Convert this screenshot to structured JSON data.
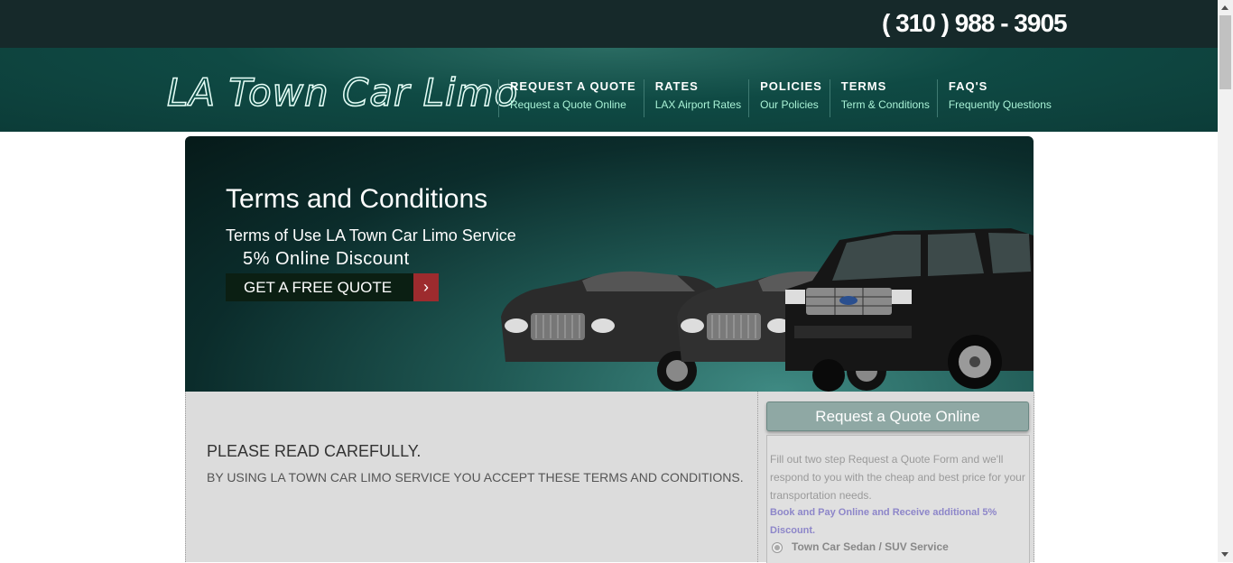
{
  "header": {
    "phone": "( 310 ) 988 - 3905",
    "logo": "LA Town Car Limo"
  },
  "nav": [
    {
      "title": "REQUEST A QUOTE",
      "sub": "Request a Quote Online"
    },
    {
      "title": "RATES",
      "sub": "LAX Airport Rates"
    },
    {
      "title": "POLICIES",
      "sub": "Our Policies"
    },
    {
      "title": "TERMS",
      "sub": "Term & Conditions"
    },
    {
      "title": "FAQ'S",
      "sub": "Frequently Questions"
    }
  ],
  "hero": {
    "title": "Terms and Conditions",
    "subtitle": "Terms of Use LA Town Car Limo Service",
    "discount": "5% Online Discount",
    "button_label": "GET A FREE QUOTE",
    "button_icon": "chevron-right-icon"
  },
  "content": {
    "heading": "PLEASE READ CAREFULLY.",
    "text": "BY USING LA TOWN CAR LIMO SERVICE YOU ACCEPT THESE TERMS AND CONDITIONS."
  },
  "sidebar": {
    "title": "Request a Quote Online",
    "intro": "Fill out two step Request a Quote Form and we'll respond to you with the cheap and best price for your transportation needs.",
    "promo": "Book and Pay Online and Receive additional 5% Discount.",
    "option_label": "Town Car Sedan / SUV Service"
  },
  "colors": {
    "topbar": "#16292a",
    "navband": "#0f4a44",
    "nav_sub": "#a9f2d6",
    "button_arrow": "#9d2b2e",
    "promo": "#8d86c9"
  }
}
